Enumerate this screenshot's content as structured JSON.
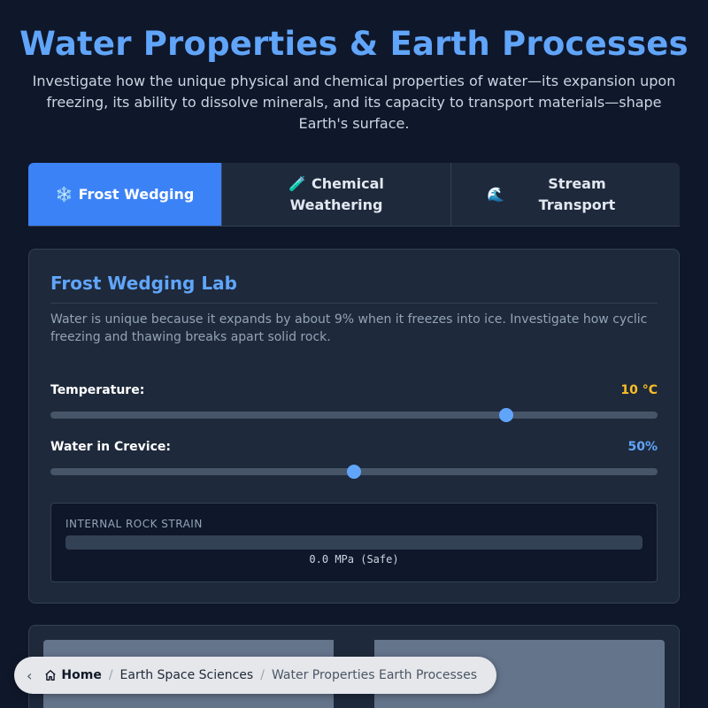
{
  "header": {
    "title": "Water Properties & Earth Processes",
    "intro": "Investigate how the unique physical and chemical properties of water—its expansion upon freezing, its ability to dissolve minerals, and its capacity to transport materials—shape Earth's surface."
  },
  "tabs": [
    {
      "icon": "❄️",
      "label": "Frost Wedging",
      "active": true
    },
    {
      "icon": "🧪",
      "label": "Chemical Weathering",
      "active": false
    },
    {
      "icon": "🌊",
      "label": "Stream Transport",
      "active": false
    }
  ],
  "lab": {
    "title": "Frost Wedging Lab",
    "description": "Water is unique because it expands by about 9% when it freezes into ice. Investigate how cyclic freezing and thawing breaks apart solid rock.",
    "temperature": {
      "label": "Temperature:",
      "value_text": "10 °C",
      "value": 10,
      "min": -20,
      "max": 20,
      "color": "#fbbf24"
    },
    "water": {
      "label": "Water in Crevice:",
      "value_text": "50%",
      "value": 50,
      "min": 0,
      "max": 100,
      "color": "#60a5fa"
    },
    "strain": {
      "label": "INTERNAL ROCK STRAIN",
      "readout": "0.0 MPa (Safe)",
      "level": 0
    }
  },
  "breadcrumb": {
    "back_icon": "chevron-left-icon",
    "home_icon": "home-icon",
    "home": "Home",
    "section": "Earth Space Sciences",
    "current": "Water Properties Earth Processes",
    "separator": "/"
  }
}
